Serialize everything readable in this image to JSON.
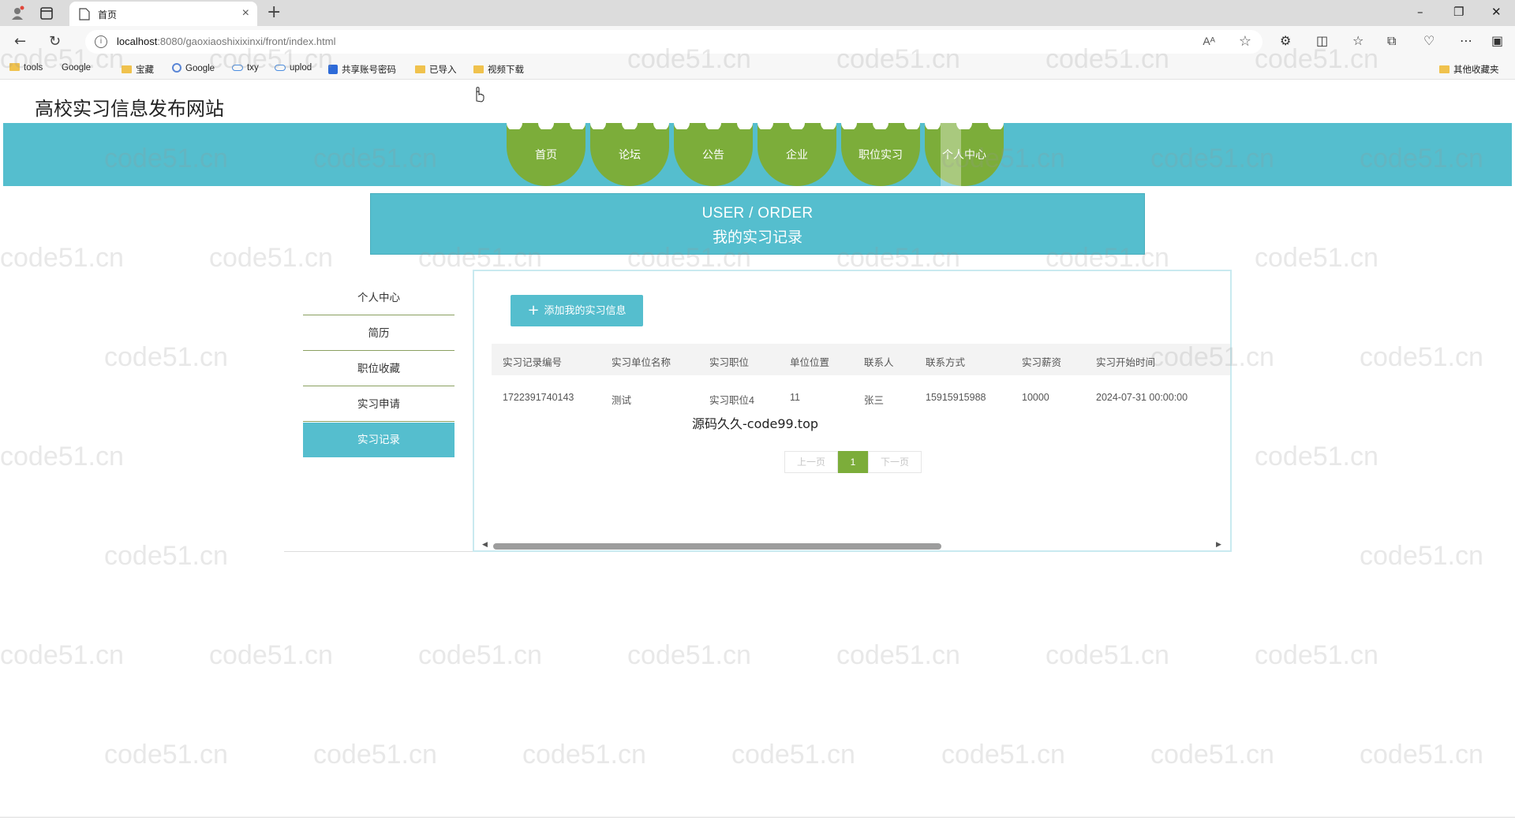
{
  "browser": {
    "tab_title": "首页",
    "url_host": "localhost",
    "url_path": ":8080/gaoxiaoshixixinxi/front/index.html",
    "reader_label": "Aᴬ"
  },
  "bookmarks": [
    {
      "label": "tools",
      "icon": "folder"
    },
    {
      "label": "Google",
      "icon": "page"
    },
    {
      "label": "宝藏",
      "icon": "folder"
    },
    {
      "label": "Google",
      "icon": "google"
    },
    {
      "label": "txy",
      "icon": "cloud"
    },
    {
      "label": "uplod",
      "icon": "cloud"
    },
    {
      "label": "共享账号密码",
      "icon": "fb"
    },
    {
      "label": "已导入",
      "icon": "folder"
    },
    {
      "label": "视频下载",
      "icon": "folder"
    }
  ],
  "other_bookmarks": "其他收藏夹",
  "site": {
    "title": "高校实习信息发布网站"
  },
  "nav": [
    {
      "label": "首页"
    },
    {
      "label": "论坛"
    },
    {
      "label": "公告"
    },
    {
      "label": "企业"
    },
    {
      "label": "职位实习"
    },
    {
      "label": "个人中心"
    }
  ],
  "banner": {
    "en": "USER / ORDER",
    "cn": "我的实习记录"
  },
  "sidebar": [
    {
      "label": "个人中心"
    },
    {
      "label": "简历"
    },
    {
      "label": "职位收藏"
    },
    {
      "label": "实习申请"
    },
    {
      "label": "实习记录",
      "active": true
    }
  ],
  "main": {
    "add_button": "添加我的实习信息",
    "columns": [
      "实习记录编号",
      "实习单位名称",
      "实习职位",
      "单位位置",
      "联系人",
      "联系方式",
      "实习薪资",
      "实习开始时间"
    ],
    "rows": [
      [
        "1722391740143",
        "测试",
        "实习职位4",
        "11",
        "张三",
        "15915915988",
        "10000",
        "2024-07-31 00:00:00"
      ]
    ],
    "overlay": "源码久久-code99.top",
    "pager": {
      "prev": "上一页",
      "current": "1",
      "next": "下一页"
    }
  },
  "watermark": "code51.cn",
  "colors": {
    "accent": "#55bece",
    "nav_item": "#7cad3a"
  }
}
